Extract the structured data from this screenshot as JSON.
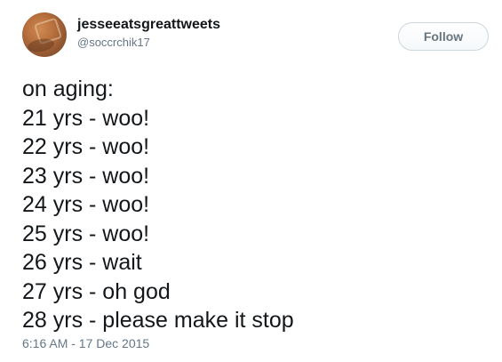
{
  "author": {
    "display_name": "jesseeatsgreattweets",
    "username": "@soccrchik17"
  },
  "follow_label": "Follow",
  "tweet": {
    "lines": [
      "on aging:",
      "21 yrs - woo!",
      "22 yrs - woo!",
      "23 yrs - woo!",
      "24 yrs - woo!",
      "25 yrs - woo!",
      "26 yrs - wait",
      "27 yrs - oh god",
      "28 yrs - please make it stop"
    ]
  },
  "timestamp": "6:16 AM - 17 Dec 2015",
  "colors": {
    "text": "#14171a",
    "secondary": "#657786",
    "button_border": "#ccd6dd"
  }
}
